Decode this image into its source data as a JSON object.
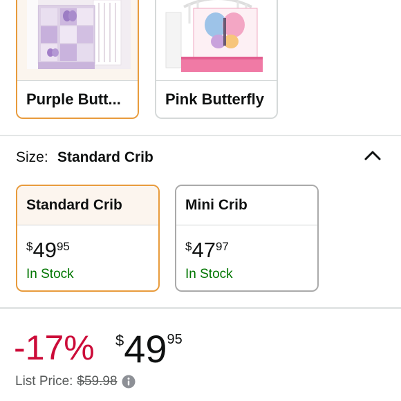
{
  "styles": [
    {
      "name": "Purple Butt...",
      "selected": true
    },
    {
      "name": "Pink Butterfly",
      "selected": false
    }
  ],
  "size": {
    "label": "Size:",
    "value": "Standard Crib",
    "toggle_icon": "chevron-up-icon",
    "options": [
      {
        "name": "Standard Crib",
        "currency": "$",
        "whole": "49",
        "fraction": "95",
        "stock": "In Stock",
        "selected": true
      },
      {
        "name": "Mini Crib",
        "currency": "$",
        "whole": "47",
        "fraction": "97",
        "stock": "In Stock",
        "selected": false
      }
    ]
  },
  "pricing": {
    "discount": "-17%",
    "currency": "$",
    "whole": "49",
    "fraction": "95",
    "list_price_label": "List Price:",
    "list_price": "$59.98",
    "info_icon": "info-icon"
  },
  "colors": {
    "selected_border": "#e89b3c",
    "discount": "#cc0c39",
    "in_stock": "#007600"
  }
}
